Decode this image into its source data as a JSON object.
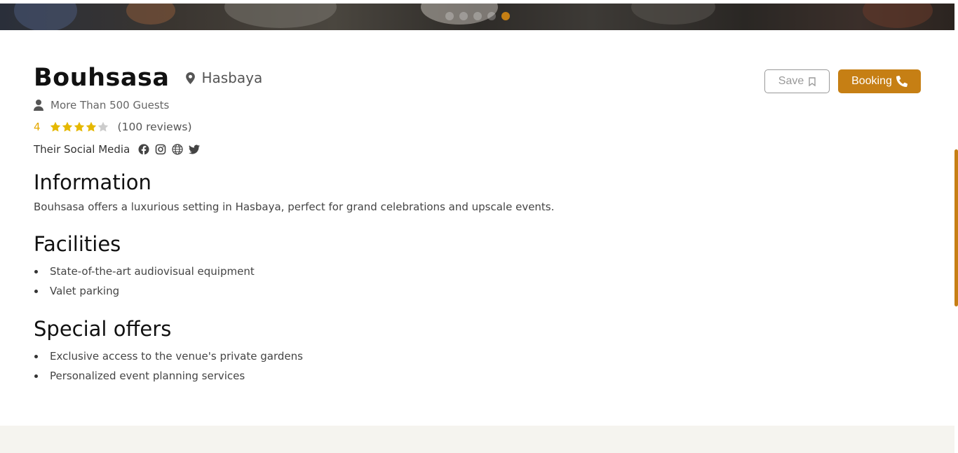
{
  "carousel": {
    "slide_count": 5,
    "active_index": 4,
    "accent": "#c67f14"
  },
  "venue": {
    "name": "Bouhsasa",
    "location": "Hasbaya",
    "guests": "More Than 500 Guests",
    "rating": "4",
    "rating_value": 4,
    "rating_max": 5,
    "reviews": "(100 reviews)",
    "social_label": "Their Social Media",
    "social_icons": [
      "facebook-icon",
      "instagram-icon",
      "globe-icon",
      "twitter-icon"
    ]
  },
  "actions": {
    "save_label": "Save",
    "booking_label": "Booking"
  },
  "information": {
    "heading": "Information",
    "text": "Bouhsasa offers a luxurious setting in Hasbaya, perfect for grand celebrations and upscale events."
  },
  "facilities": {
    "heading": "Facilities",
    "items": [
      "State-of-the-art audiovisual equipment",
      "Valet parking"
    ]
  },
  "special_offers": {
    "heading": "Special offers",
    "items": [
      "Exclusive access to the venue's private gardens",
      "Personalized event planning services"
    ]
  },
  "colors": {
    "accent": "#c67f14",
    "star": "#e5b800",
    "star_empty": "#cccccc"
  }
}
